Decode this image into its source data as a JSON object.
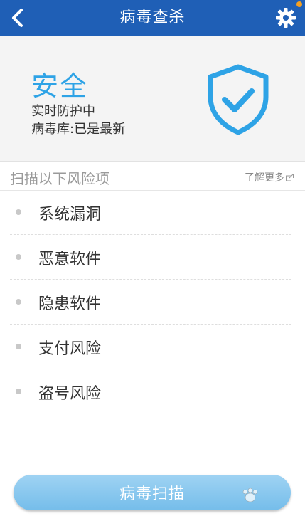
{
  "header": {
    "title": "病毒查杀",
    "back_icon": "chevron-left-icon",
    "settings_icon": "gear-icon",
    "background": "#1f5fb6",
    "notification_color": "#f5a020"
  },
  "status": {
    "state": "安全",
    "line1": "实时防护中",
    "line2": "病毒库:已是最新",
    "accent": "#2ea3e6",
    "icon": "shield-check-icon"
  },
  "section": {
    "title": "扫描以下风险项",
    "learn_more": "了解更多",
    "learn_more_icon": "external-link-icon"
  },
  "risks": [
    {
      "label": "系统漏洞"
    },
    {
      "label": "恶意软件"
    },
    {
      "label": "隐患软件"
    },
    {
      "label": "支付风险"
    },
    {
      "label": "盗号风险"
    }
  ],
  "scan_button": {
    "label": "病毒扫描",
    "color": "#8ccaf0"
  }
}
